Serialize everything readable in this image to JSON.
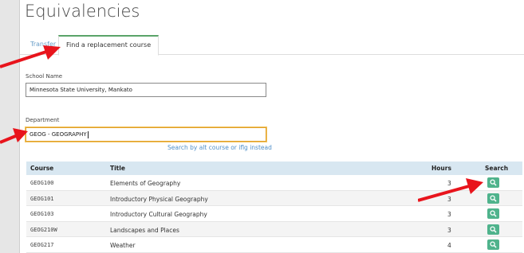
{
  "page": {
    "title": "Equivalencies"
  },
  "tabs": [
    {
      "label": "Transfer",
      "active": false
    },
    {
      "label": "Find a replacement course",
      "active": true
    }
  ],
  "school": {
    "label": "School Name",
    "value": "Minnesota State University, Mankato"
  },
  "department": {
    "label": "Department",
    "value": "GEOG - GEOGRAPHY"
  },
  "alt_search_link": "Search by alt course or iflg instead",
  "table": {
    "headers": {
      "course": "Course",
      "title": "Title",
      "hours": "Hours",
      "search": "Search"
    },
    "rows": [
      {
        "course": "GEOG100",
        "title": "Elements of Geography",
        "hours": "3"
      },
      {
        "course": "GEOG101",
        "title": "Introductory Physical Geography",
        "hours": "3"
      },
      {
        "course": "GEOG103",
        "title": "Introductory Cultural Geography",
        "hours": "3"
      },
      {
        "course": "GEOG210W",
        "title": "Landscapes and Places",
        "hours": "3"
      },
      {
        "course": "GEOG217",
        "title": "Weather",
        "hours": "4"
      }
    ]
  },
  "colors": {
    "accent_green": "#4fb38c",
    "arrow_red": "#e8141c",
    "focus_orange": "#e0a02a",
    "link_blue": "#4f8fc9"
  }
}
